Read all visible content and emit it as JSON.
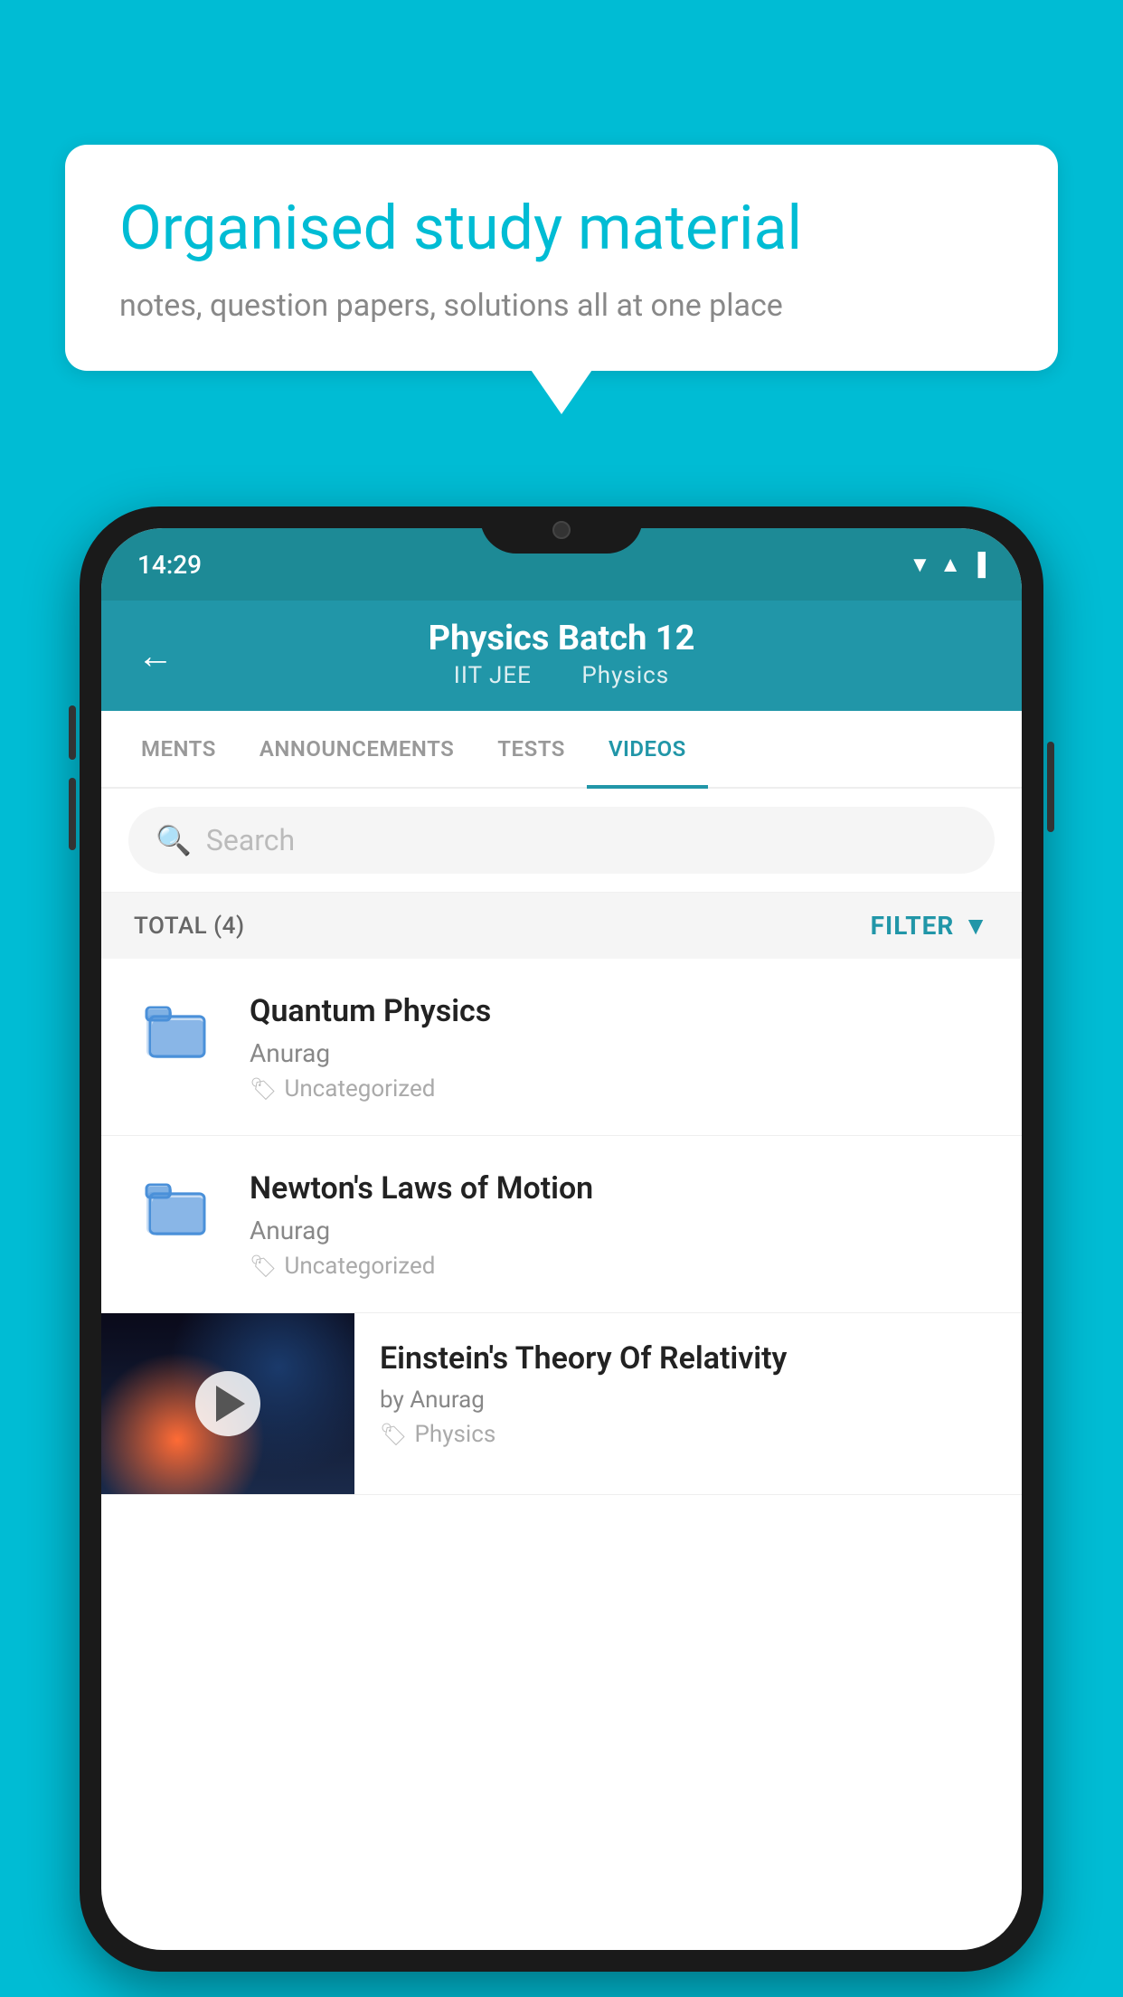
{
  "background_color": "#00bcd4",
  "speech_bubble": {
    "title": "Organised study material",
    "subtitle": "notes, question papers, solutions all at one place"
  },
  "phone": {
    "status_bar": {
      "time": "14:29"
    },
    "app_header": {
      "title": "Physics Batch 12",
      "subtitle1": "IIT JEE",
      "subtitle2": "Physics",
      "back_label": "←"
    },
    "tabs": [
      {
        "label": "MENTS",
        "active": false
      },
      {
        "label": "ANNOUNCEMENTS",
        "active": false
      },
      {
        "label": "TESTS",
        "active": false
      },
      {
        "label": "VIDEOS",
        "active": true
      }
    ],
    "search": {
      "placeholder": "Search"
    },
    "filter_row": {
      "total_label": "TOTAL (4)",
      "filter_label": "FILTER"
    },
    "videos": [
      {
        "id": 1,
        "title": "Quantum Physics",
        "author": "Anurag",
        "tag": "Uncategorized",
        "has_thumbnail": false
      },
      {
        "id": 2,
        "title": "Newton's Laws of Motion",
        "author": "Anurag",
        "tag": "Uncategorized",
        "has_thumbnail": false
      },
      {
        "id": 3,
        "title": "Einstein's Theory Of Relativity",
        "author": "by Anurag",
        "tag": "Physics",
        "has_thumbnail": true
      }
    ]
  }
}
